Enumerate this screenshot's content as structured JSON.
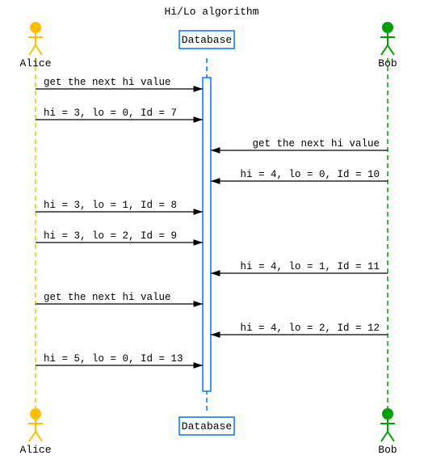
{
  "title": "Hi/Lo algorithm",
  "actors": {
    "alice": {
      "name": "Alice",
      "color": "#ffbf00"
    },
    "database": {
      "name": "Database",
      "color": "#0072ff"
    },
    "bob": {
      "name": "Bob",
      "color": "#00a000"
    }
  },
  "messages": [
    {
      "from": "alice",
      "to": "database",
      "text": "get the next hi value"
    },
    {
      "from": "alice",
      "to": "database",
      "text": "hi = 3, lo = 0, Id = 7"
    },
    {
      "from": "bob",
      "to": "database",
      "text": "get the next hi value"
    },
    {
      "from": "bob",
      "to": "database",
      "text": "hi = 4, lo = 0, Id = 10"
    },
    {
      "from": "alice",
      "to": "database",
      "text": "hi = 3, lo = 1, Id = 8"
    },
    {
      "from": "alice",
      "to": "database",
      "text": "hi = 3, lo = 2, Id = 9"
    },
    {
      "from": "bob",
      "to": "database",
      "text": "hi = 4, lo = 1, Id = 11"
    },
    {
      "from": "alice",
      "to": "database",
      "text": "get the next hi value"
    },
    {
      "from": "bob",
      "to": "database",
      "text": "hi = 4, lo = 2, Id = 12"
    },
    {
      "from": "alice",
      "to": "database",
      "text": "hi = 5, lo = 0, Id = 13"
    }
  ],
  "chart_data": {
    "type": "sequence-diagram",
    "title": "Hi/Lo algorithm",
    "participants": [
      "Alice",
      "Database",
      "Bob"
    ],
    "events": [
      {
        "from": "Alice",
        "to": "Database",
        "label": "get the next hi value"
      },
      {
        "from": "Alice",
        "to": "Database",
        "label": "hi = 3, lo = 0, Id = 7"
      },
      {
        "from": "Bob",
        "to": "Database",
        "label": "get the next hi value"
      },
      {
        "from": "Bob",
        "to": "Database",
        "label": "hi = 4, lo = 0, Id = 10"
      },
      {
        "from": "Alice",
        "to": "Database",
        "label": "hi = 3, lo = 1, Id = 8"
      },
      {
        "from": "Alice",
        "to": "Database",
        "label": "hi = 3, lo = 2, Id = 9"
      },
      {
        "from": "Bob",
        "to": "Database",
        "label": "hi = 4, lo = 1, Id = 11"
      },
      {
        "from": "Alice",
        "to": "Database",
        "label": "get the next hi value"
      },
      {
        "from": "Bob",
        "to": "Database",
        "label": "hi = 4, lo = 2, Id = 12"
      },
      {
        "from": "Alice",
        "to": "Database",
        "label": "hi = 5, lo = 0, Id = 13"
      }
    ]
  }
}
